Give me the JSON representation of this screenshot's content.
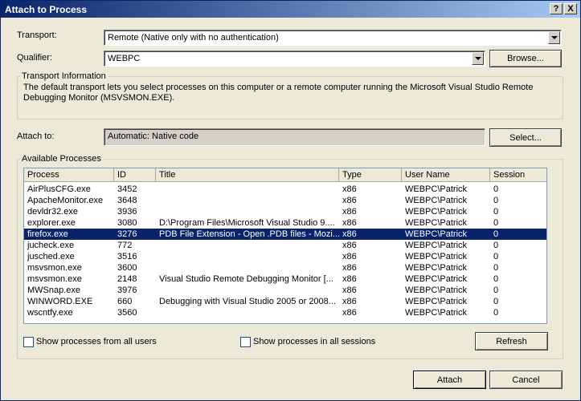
{
  "window": {
    "title": "Attach to Process",
    "help_glyph": "?",
    "close_glyph": "X"
  },
  "transport": {
    "label": "Transport:",
    "value": "Remote (Native only with no authentication)"
  },
  "qualifier": {
    "label": "Qualifier:",
    "value": "WEBPC",
    "browse_label": "Browse..."
  },
  "transport_info": {
    "title": "Transport Information",
    "text": "The default transport lets you select processes on this computer or a remote computer running the Microsoft Visual Studio Remote Debugging Monitor (MSVSMON.EXE)."
  },
  "attach_to": {
    "label": "Attach to:",
    "value": "Automatic: Native code",
    "select_label": "Select..."
  },
  "processes": {
    "title": "Available Processes",
    "columns": [
      "Process",
      "ID",
      "Title",
      "Type",
      "User Name",
      "Session"
    ],
    "rows": [
      {
        "process": "AirPlusCFG.exe",
        "id": "3452",
        "title": "",
        "type": "x86",
        "user": "WEBPC\\Patrick",
        "session": "0"
      },
      {
        "process": "ApacheMonitor.exe",
        "id": "3648",
        "title": "",
        "type": "x86",
        "user": "WEBPC\\Patrick",
        "session": "0"
      },
      {
        "process": "devldr32.exe",
        "id": "3936",
        "title": "",
        "type": "x86",
        "user": "WEBPC\\Patrick",
        "session": "0"
      },
      {
        "process": "explorer.exe",
        "id": "3080",
        "title": "D:\\Program Files\\Microsoft Visual Studio 9....",
        "type": "x86",
        "user": "WEBPC\\Patrick",
        "session": "0"
      },
      {
        "process": "firefox.exe",
        "id": "3276",
        "title": "PDB File Extension - Open .PDB files - Mozi...",
        "type": "x86",
        "user": "WEBPC\\Patrick",
        "session": "0",
        "selected": true
      },
      {
        "process": "jucheck.exe",
        "id": "772",
        "title": "",
        "type": "x86",
        "user": "WEBPC\\Patrick",
        "session": "0"
      },
      {
        "process": "jusched.exe",
        "id": "3516",
        "title": "",
        "type": "x86",
        "user": "WEBPC\\Patrick",
        "session": "0"
      },
      {
        "process": "msvsmon.exe",
        "id": "3600",
        "title": "",
        "type": "x86",
        "user": "WEBPC\\Patrick",
        "session": "0"
      },
      {
        "process": "msvsmon.exe",
        "id": "2148",
        "title": "Visual Studio Remote Debugging Monitor [...",
        "type": "x86",
        "user": "WEBPC\\Patrick",
        "session": "0"
      },
      {
        "process": "MWSnap.exe",
        "id": "3976",
        "title": "",
        "type": "x86",
        "user": "WEBPC\\Patrick",
        "session": "0"
      },
      {
        "process": "WINWORD.EXE",
        "id": "660",
        "title": "Debugging with Visual Studio 2005 or 2008...",
        "type": "x86",
        "user": "WEBPC\\Patrick",
        "session": "0"
      },
      {
        "process": "wscntfy.exe",
        "id": "3560",
        "title": "",
        "type": "x86",
        "user": "WEBPC\\Patrick",
        "session": "0"
      }
    ],
    "show_all_users_label": "Show processes from all users",
    "show_all_sessions_label": "Show processes in all sessions",
    "refresh_label": "Refresh"
  },
  "footer": {
    "attach_label": "Attach",
    "cancel_label": "Cancel"
  }
}
